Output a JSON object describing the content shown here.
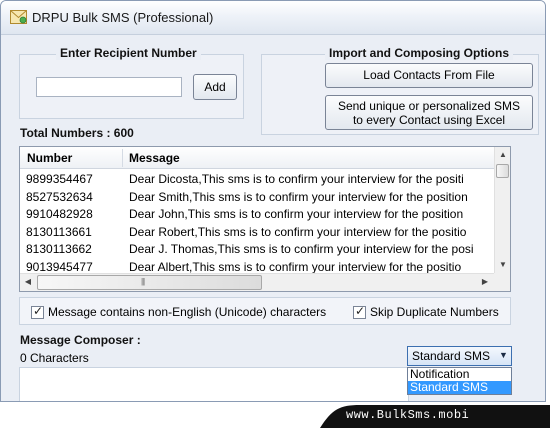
{
  "window": {
    "title": "DRPU Bulk SMS (Professional)"
  },
  "recipient": {
    "heading": "Enter Recipient Number",
    "input_value": "",
    "add_label": "Add"
  },
  "import": {
    "heading": "Import and Composing Options",
    "load_label": "Load Contacts From File",
    "send_line1": "Send unique or personalized SMS",
    "send_line2": "to every Contact using Excel"
  },
  "total_numbers": "Total Numbers : 600",
  "grid": {
    "col_number": "Number",
    "col_message": "Message",
    "rows": [
      {
        "number": "9899354467",
        "message": "Dear Dicosta,This sms is to confirm your interview for the positi"
      },
      {
        "number": "8527532634",
        "message": "Dear Smith,This sms is to confirm your interview for the position"
      },
      {
        "number": "9910482928",
        "message": "Dear John,This sms is to confirm your interview for the position"
      },
      {
        "number": "8130113661",
        "message": "Dear Robert,This sms is to confirm your interview for the positio"
      },
      {
        "number": "8130113662",
        "message": "Dear J. Thomas,This sms is to confirm your interview for the posi"
      },
      {
        "number": "9013945477",
        "message": "Dear Albert,This sms is to confirm your interview for the positio"
      }
    ]
  },
  "options": {
    "unicode_label": "Message contains non-English (Unicode) characters",
    "unicode_checked": true,
    "skip_label": "Skip Duplicate Numbers",
    "skip_checked": true
  },
  "composer": {
    "heading": "Message Composer :",
    "char_count": "0 Characters",
    "selected": "Standard SMS",
    "options": [
      "Notification",
      "Standard SMS"
    ],
    "highlighted_option": "Standard SMS"
  },
  "brand": {
    "text": "www.BulkSms.mobi"
  },
  "colors": {
    "accent": "#3c6fb0",
    "selection": "#3399ff",
    "window_bg": "#eaeef5"
  }
}
